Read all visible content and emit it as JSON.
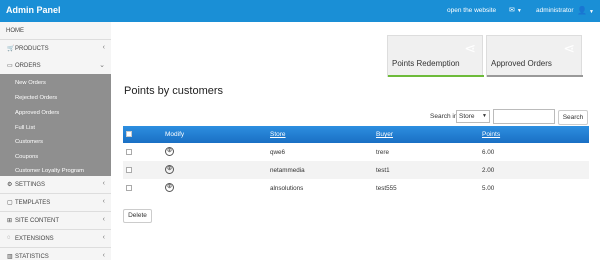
{
  "header": {
    "brand": "Admin Panel",
    "website_link": "open the website",
    "mail_icon": "envelope-icon",
    "user_label": "administrator",
    "user_icon": "user-icon"
  },
  "sidebar": {
    "items": [
      {
        "label": "HOME",
        "icon": ""
      },
      {
        "label": "PRODUCTS",
        "icon": "cart-icon"
      },
      {
        "label": "ORDERS",
        "icon": "orders-icon"
      },
      {
        "label": "SETTINGS",
        "icon": "gears-icon"
      },
      {
        "label": "TEMPLATES",
        "icon": "template-icon"
      },
      {
        "label": "SITE CONTENT",
        "icon": "sitemap-icon"
      },
      {
        "label": "EXTENSIONS",
        "icon": "circle-icon"
      },
      {
        "label": "STATISTICS",
        "icon": "chart-icon"
      }
    ],
    "orders_submenu": [
      "New Orders",
      "Rejected Orders",
      "Approved Orders",
      "Full List",
      "Customers",
      "Coupons",
      "Customer Loyalty Program"
    ]
  },
  "cards": [
    {
      "title": "Points Redemption",
      "accent": "#6dbb3a"
    },
    {
      "title": "Approved Orders",
      "accent": "#999999"
    }
  ],
  "page_title": "Points by customers",
  "search": {
    "label": "Search in",
    "select_value": "Store",
    "input_value": "",
    "button": "Search"
  },
  "table": {
    "columns": [
      "Modify",
      "Store",
      "Buyer",
      "Points"
    ],
    "rows": [
      {
        "store": "qwe6",
        "buyer": "trere",
        "points": "6.00"
      },
      {
        "store": "netammedia",
        "buyer": "test1",
        "points": "2.00"
      },
      {
        "store": "alnsolutions",
        "buyer": "test555",
        "points": "5.00"
      }
    ]
  },
  "delete_button": "Delete",
  "colors": {
    "header_bg": "#1a8fd6",
    "submenu_bg": "#8f8f8f",
    "table_header": "#1f7fd0"
  }
}
